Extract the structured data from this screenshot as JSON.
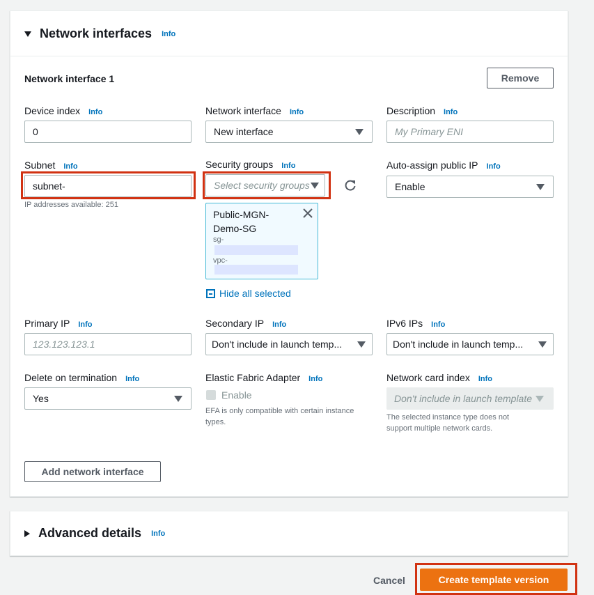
{
  "network": {
    "section_title": "Network interfaces",
    "info": "Info",
    "interface_title": "Network interface 1",
    "remove_label": "Remove",
    "device_index": {
      "label": "Device index",
      "value": "0"
    },
    "network_interface": {
      "label": "Network interface",
      "value": "New interface"
    },
    "description": {
      "label": "Description",
      "placeholder": "My Primary ENI"
    },
    "subnet": {
      "label": "Subnet",
      "value": "subnet-",
      "hint": "IP addresses available: 251"
    },
    "security_groups": {
      "label": "Security groups",
      "placeholder": "Select security groups",
      "selected": {
        "name_line1": "Public-MGN-",
        "name_line2": "Demo-SG",
        "sg_prefix": "sg-",
        "vpc_prefix": "vpc-"
      },
      "hide_label": "Hide all selected"
    },
    "auto_assign": {
      "label": "Auto-assign public IP",
      "value": "Enable"
    },
    "primary_ip": {
      "label": "Primary IP",
      "placeholder": "123.123.123.1"
    },
    "secondary_ip": {
      "label": "Secondary IP",
      "value": "Don't include in launch temp..."
    },
    "ipv6": {
      "label": "IPv6 IPs",
      "value": "Don't include in launch temp..."
    },
    "delete_on_termination": {
      "label": "Delete on termination",
      "value": "Yes"
    },
    "efa": {
      "label": "Elastic Fabric Adapter",
      "checkbox_label": "Enable",
      "hint_line1": "EFA is only compatible with certain instance",
      "hint_line2": "types."
    },
    "network_card_index": {
      "label": "Network card index",
      "value": "Don't include in launch template",
      "hint_line1": "The selected instance type does not",
      "hint_line2": "support multiple network cards."
    },
    "add_label": "Add network interface"
  },
  "advanced": {
    "title": "Advanced details",
    "info": "Info"
  },
  "footer": {
    "cancel_label": "Cancel",
    "create_label": "Create template version"
  },
  "colors": {
    "accent": "#ec7211",
    "link": "#0073bb",
    "highlight": "#d13212"
  }
}
